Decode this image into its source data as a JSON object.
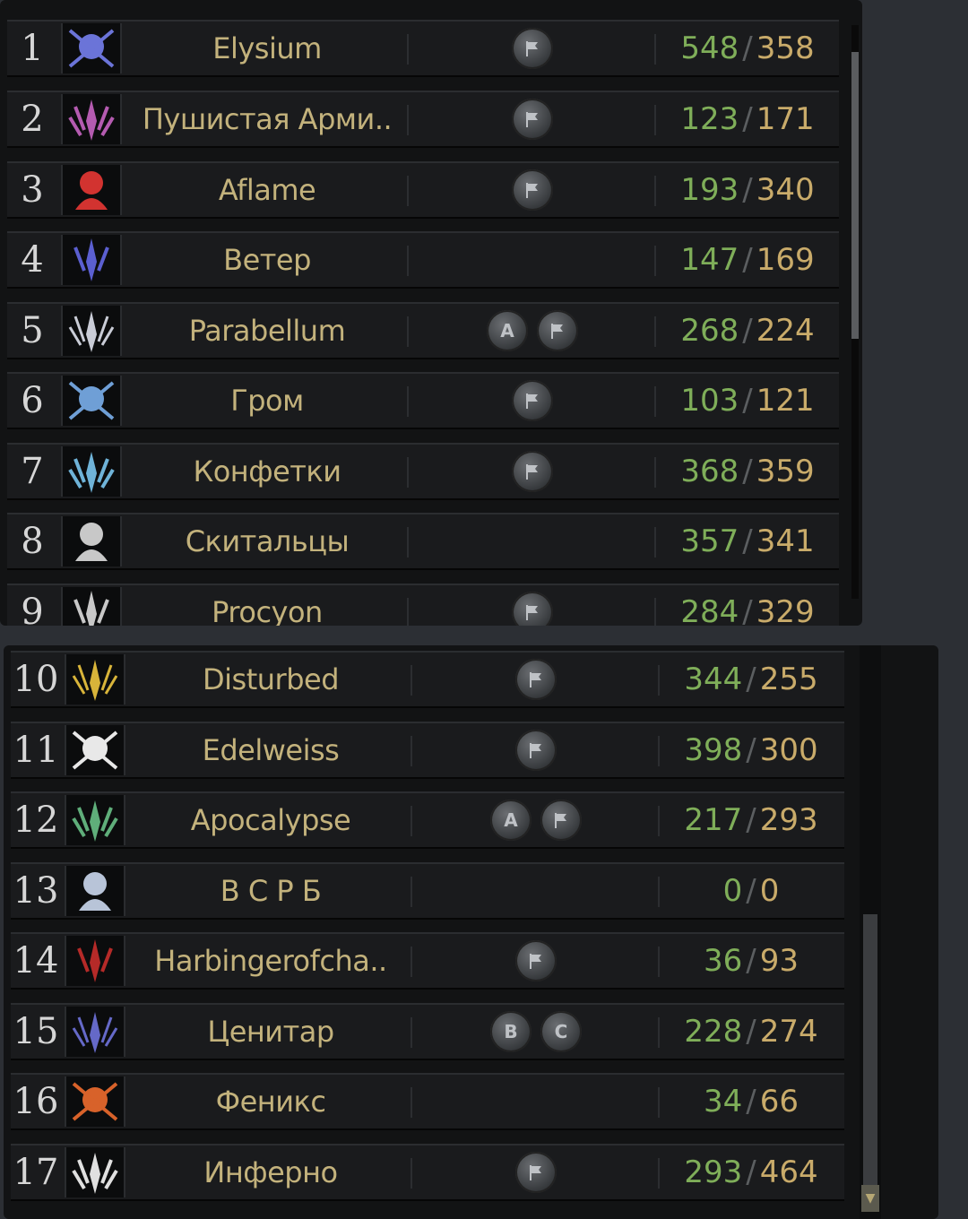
{
  "rows": [
    {
      "rank": "1",
      "name": "Elysium",
      "badges": [
        "flag"
      ],
      "wins": "548",
      "losses": "358",
      "emblem_color": "#6b74d8"
    },
    {
      "rank": "2",
      "name": "Пушистая Арми..",
      "badges": [
        "flag"
      ],
      "wins": "123",
      "losses": "171",
      "emblem_color": "#b45bb0"
    },
    {
      "rank": "3",
      "name": "Aflame",
      "badges": [
        "flag"
      ],
      "wins": "193",
      "losses": "340",
      "emblem_color": "#d23330"
    },
    {
      "rank": "4",
      "name": "Ветер",
      "badges": [],
      "wins": "147",
      "losses": "169",
      "emblem_color": "#5b5fd0"
    },
    {
      "rank": "5",
      "name": "Parabellum",
      "badges": [
        "A",
        "flag"
      ],
      "wins": "268",
      "losses": "224",
      "emblem_color": "#c9ccd6"
    },
    {
      "rank": "6",
      "name": "Гром",
      "badges": [
        "flag"
      ],
      "wins": "103",
      "losses": "121",
      "emblem_color": "#6f9fd6"
    },
    {
      "rank": "7",
      "name": "Конфетки",
      "badges": [
        "flag"
      ],
      "wins": "368",
      "losses": "359",
      "emblem_color": "#6fb3d8"
    },
    {
      "rank": "8",
      "name": "Скитальцы",
      "badges": [],
      "wins": "357",
      "losses": "341",
      "emblem_color": "#c8c8c8"
    },
    {
      "rank": "9",
      "name": "Procyon",
      "badges": [
        "flag"
      ],
      "wins": "284",
      "losses": "329",
      "emblem_color": "#c8c8c8"
    },
    {
      "rank": "10",
      "name": "Disturbed",
      "badges": [
        "flag"
      ],
      "wins": "344",
      "losses": "255",
      "emblem_color": "#d8b43a"
    },
    {
      "rank": "11",
      "name": "Edelweiss",
      "badges": [
        "flag"
      ],
      "wins": "398",
      "losses": "300",
      "emblem_color": "#e8e8e8"
    },
    {
      "rank": "12",
      "name": "Apocalypse",
      "badges": [
        "A",
        "flag"
      ],
      "wins": "217",
      "losses": "293",
      "emblem_color": "#5fae7a"
    },
    {
      "rank": "13",
      "name": "В С Р Б",
      "badges": [],
      "wins": "0",
      "losses": "0",
      "emblem_color": "#b8c4d8"
    },
    {
      "rank": "14",
      "name": "Harbingerofcha..",
      "badges": [
        "flag"
      ],
      "wins": "36",
      "losses": "93",
      "emblem_color": "#b52a28"
    },
    {
      "rank": "15",
      "name": "Ценитар",
      "badges": [
        "B",
        "C"
      ],
      "wins": "228",
      "losses": "274",
      "emblem_color": "#6569c8"
    },
    {
      "rank": "16",
      "name": "Феникс",
      "badges": [],
      "wins": "34",
      "losses": "66",
      "emblem_color": "#d8622a"
    },
    {
      "rank": "17",
      "name": "Инферно",
      "badges": [
        "flag"
      ],
      "wins": "293",
      "losses": "464",
      "emblem_color": "#e0e0e0"
    }
  ],
  "separator": "/"
}
